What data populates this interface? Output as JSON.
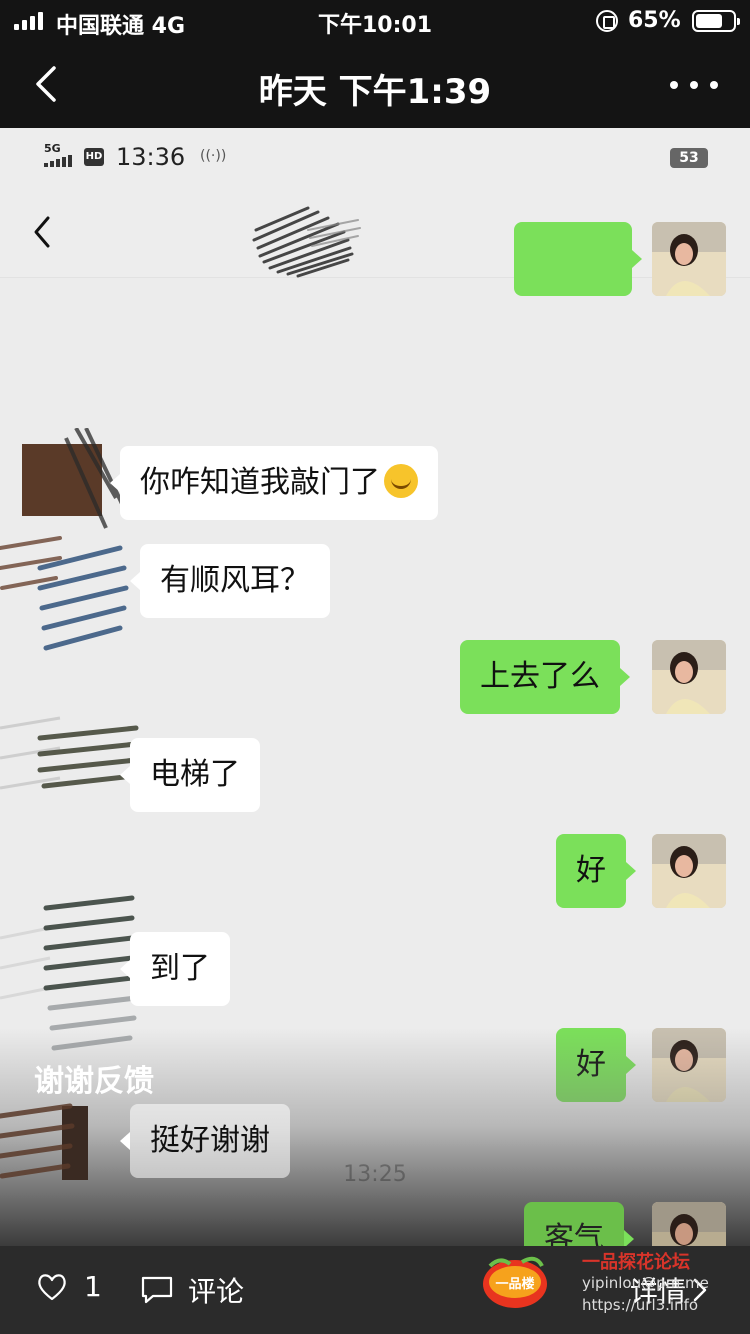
{
  "outer_status": {
    "carrier": "中国联通  4G",
    "time": "下午10:01",
    "battery": "65%"
  },
  "outer_header": {
    "title": "昨天 下午1:39"
  },
  "inner_status": {
    "network": "5G",
    "hd": "HD",
    "time": "13:36",
    "battery": "53"
  },
  "messages": [
    {
      "side": "out",
      "text": ""
    },
    {
      "side": "in",
      "text": "你咋知道我敲门了",
      "emoji": "laughing-crying-emoji"
    },
    {
      "side": "in",
      "text": "有顺风耳？"
    },
    {
      "side": "out",
      "text": "上去了么"
    },
    {
      "side": "in",
      "text": "电梯了"
    },
    {
      "side": "out",
      "text": "好"
    },
    {
      "side": "in",
      "text": "到了"
    },
    {
      "side": "out",
      "text": "好"
    },
    {
      "side": "divider",
      "text": "13:25"
    },
    {
      "side": "in",
      "text": "挺好谢谢"
    },
    {
      "side": "out",
      "text": "客气"
    }
  ],
  "caption": "谢谢反馈",
  "action_bar": {
    "likes": "1",
    "comment_label": "评论",
    "details_label": "详情"
  },
  "watermark": {
    "logo_text": "一品楼",
    "title": "一品探花论坛",
    "email": "yipinlou@pm.me",
    "url": "https://url3.info"
  }
}
